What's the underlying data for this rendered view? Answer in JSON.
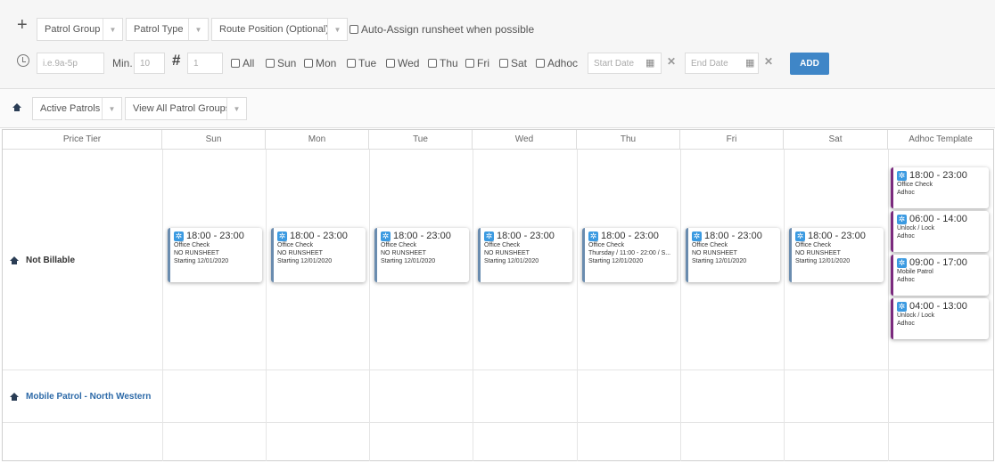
{
  "toolbar": {
    "patrol_group": "Patrol Group",
    "patrol_type": "Patrol Type",
    "route_position": "Route Position (Optional)",
    "auto_assign": "Auto-Assign runsheet when possible",
    "time_placeholder": "i.e.9a-5p",
    "min_label": "Min.",
    "min_value": "10",
    "hash_label": "#",
    "count_value": "1",
    "days": [
      "All",
      "Sun",
      "Mon",
      "Tue",
      "Wed",
      "Thu",
      "Fri",
      "Sat",
      "Adhoc"
    ],
    "start_date": "Start Date",
    "end_date": "End Date",
    "add_label": "ADD"
  },
  "filter": {
    "active_patrols": "Active Patrols",
    "view_all": "View All Patrol Groups"
  },
  "grid": {
    "headers": [
      "Price Tier",
      "Sun",
      "Mon",
      "Tue",
      "Wed",
      "Thu",
      "Fri",
      "Sat",
      "Adhoc Template"
    ],
    "rows": [
      {
        "label": "Not Billable"
      },
      {
        "label": "Mobile Patrol - North Western"
      }
    ],
    "cards": [
      {
        "time": "18:00 - 23:00",
        "l1": "Office Check",
        "l2": "NO RUNSHEET",
        "l3": "Starting 12/01/2020"
      },
      {
        "time": "18:00 - 23:00",
        "l1": "Office Check",
        "l2": "NO RUNSHEET",
        "l3": "Starting 12/01/2020"
      },
      {
        "time": "18:00 - 23:00",
        "l1": "Office Check",
        "l2": "NO RUNSHEET",
        "l3": "Starting 12/01/2020"
      },
      {
        "time": "18:00 - 23:00",
        "l1": "Office Check",
        "l2": "NO RUNSHEET",
        "l3": "Starting 12/01/2020"
      },
      {
        "time": "18:00 - 23:00",
        "l1": "Office Check",
        "l2": "Thursday / 11:00 - 22:00 / S...",
        "l3": "Starting 12/01/2020"
      },
      {
        "time": "18:00 - 23:00",
        "l1": "Office Check",
        "l2": "NO RUNSHEET",
        "l3": "Starting 12/01/2020"
      },
      {
        "time": "18:00 - 23:00",
        "l1": "Office Check",
        "l2": "NO RUNSHEET",
        "l3": "Starting 12/01/2020"
      }
    ],
    "adhoc": [
      {
        "time": "18:00 - 23:00",
        "l1": "Office Check",
        "l2": "Adhoc"
      },
      {
        "time": "06:00 - 14:00",
        "l1": "Unlock / Lock",
        "l2": "Adhoc"
      },
      {
        "time": "09:00 - 17:00",
        "l1": "Mobile Patrol",
        "l2": "Adhoc"
      },
      {
        "time": "04:00 - 13:00",
        "l1": "Unlock / Lock",
        "l2": "Adhoc"
      }
    ]
  },
  "colors": {
    "accent": "#3f86c7",
    "card_border": "#6a8caf",
    "adhoc_border": "#7b2a7e",
    "row_label_blue": "#2d6aa8"
  }
}
